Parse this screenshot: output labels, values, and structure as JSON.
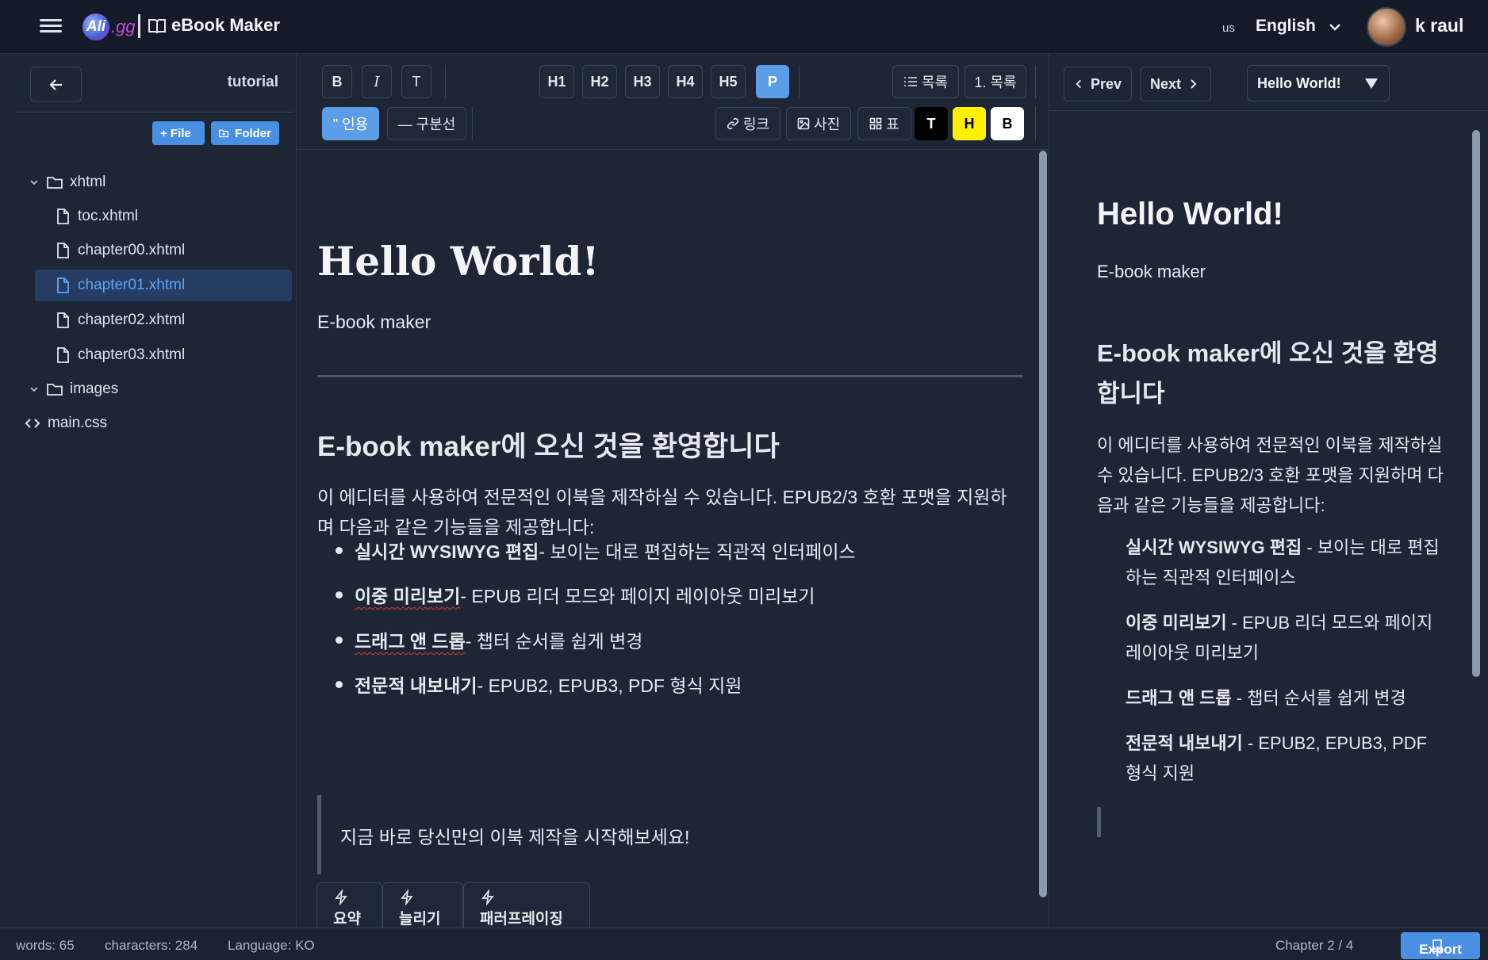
{
  "header": {
    "logo_text": "Ali",
    "logo_suffix": ".gg",
    "app_title": "eBook Maker",
    "language_code": "us",
    "language_name": "English",
    "user_name": "k raul"
  },
  "sidebar": {
    "project_name": "tutorial",
    "add_file_label": "+ File",
    "add_folder_label": "Folder",
    "tree": [
      {
        "label": "xhtml",
        "type": "folder",
        "expanded": true
      },
      {
        "label": "toc.xhtml",
        "type": "file"
      },
      {
        "label": "chapter00.xhtml",
        "type": "file"
      },
      {
        "label": "chapter01.xhtml",
        "type": "file",
        "selected": true
      },
      {
        "label": "chapter02.xhtml",
        "type": "file"
      },
      {
        "label": "chapter03.xhtml",
        "type": "file"
      },
      {
        "label": "images",
        "type": "folder",
        "expanded": true
      },
      {
        "label": "main.css",
        "type": "code"
      }
    ]
  },
  "toolbar": {
    "bold": "B",
    "italic": "I",
    "text": "T",
    "h1": "H1",
    "h2": "H2",
    "h3": "H3",
    "h4": "H4",
    "h5": "H5",
    "p": "P",
    "bullet_list": "목록",
    "numbered_list": "1. 목록",
    "quote": "\" 인용",
    "divider": "— 구분선",
    "link": "링크",
    "image": "사진",
    "table": "표",
    "color_t": "T",
    "color_h": "H",
    "color_b": "B",
    "accent_color": "#5c9de8"
  },
  "editor": {
    "title": "Hello World!",
    "subtitle": "E-book maker",
    "heading": "E-book maker에 오신 것을 환영합니다",
    "intro": "이 에디터를 사용하여 전문적인 이북을 제작하실 수 있습니다. EPUB2/3 호환 포맷을 지원하며 다음과 같은 기능들을 제공합니다:",
    "features": [
      {
        "bold": "실시간 WYSIWYG 편집",
        "rest": " - 보이는 대로 편집하는 직관적 인터페이스"
      },
      {
        "bold": "이중 미리보기",
        "rest": " - EPUB 리더 모드와 페이지 레이아웃 미리보기"
      },
      {
        "bold": "드래그 앤 드롭",
        "rest": " - 챕터 순서를 쉽게 변경"
      },
      {
        "bold": "전문적 내보내기",
        "rest": " - EPUB2, EPUB3, PDF 형식 지원"
      }
    ],
    "quote": "지금 바로 당신만의 이북 제작을 시작해보세요!",
    "ai_buttons": [
      "요약",
      "늘리기",
      "패러프레이징"
    ]
  },
  "preview": {
    "prev_label": "Prev",
    "next_label": "Next",
    "chapter_select": "Hello World!",
    "title": "Hello World!",
    "subtitle": "E-book maker",
    "heading": "E-book maker에 오신 것을 환영합니다",
    "intro": "이 에디터를 사용하여 전문적인 이북을 제작하실 수 있습니다. EPUB2/3 호환 포맷을 지원하며 다음과 같은 기능들을 제공합니다:"
  },
  "status": {
    "words": "words: 65",
    "characters": "characters: 284",
    "language": "Language: KO",
    "chapter": "Chapter 2 / 4",
    "export_label": "Export"
  }
}
